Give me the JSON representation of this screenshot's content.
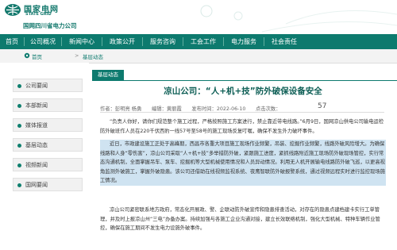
{
  "header": {
    "logo_cn": "国家电网",
    "logo_en": "STATE GRID",
    "company": "国网四川省电力公司"
  },
  "nav": {
    "items": [
      {
        "label": "首页"
      },
      {
        "label": "公司概况"
      },
      {
        "label": "新闻中心"
      },
      {
        "label": "政策公开"
      },
      {
        "label": "服务咨询"
      },
      {
        "label": "工会工作"
      },
      {
        "label": "电力服务"
      },
      {
        "label": "社会责任"
      }
    ]
  },
  "breadcrumb": {
    "home": "首页",
    "sep": ">",
    "current": "基层动态"
  },
  "sidebar": {
    "items": [
      {
        "label": "公司要闻"
      },
      {
        "label": "本部新闻"
      },
      {
        "label": "媒体报道"
      },
      {
        "label": "基层动态"
      },
      {
        "label": "视频新闻"
      },
      {
        "label": "国网要闻"
      }
    ]
  },
  "article": {
    "tab": "基层动态",
    "title": "凉山公司：“人+机+技”防外破保设备安全",
    "meta": "作者：彭明亮 杨勇　　编辑：黄丽霞　　发布时间：2022-06-10　　点击次数：",
    "count": "57",
    "paragraphs": [
      "“负责人你好，请你们规范整个施工过程，严格按照施工方案进行，禁止靠近带电线路。”6月9日，国网凉山供电公司输电运检防外破班作人员在220千伏西豹一线57号至58号的施工现场反复叮嘱，确保不发生外力破坏事件。",
      "近日，市政建设施工正处于高峰期，西昌市各重大项目施工现场作业频繁，吊装、挖掘作业频繁，线路外破风险增大。为确保线路和人身“零伤害”，凉山公司采取“人+机+技”多举措防外破，紧跟施工进度，紧抓线路附近施工现场防外破现场管控，实行常态沟通机制，全面掌握吊车、泵车、挖掘机等大型机械使用情况和人员异动情况。利用无人机开展输电线路防外破飞巡，以更高视角监测外破施工，掌握外破隐患。该公司还借助在线视频监视系统、夜鹰智联防外破报警系统，通过视频远程实时进行监控现场施工情况。",
      "凉山公司紧密联系地方政府，常态化开展政、警、企联动防外破宣传和隐患排查活动，对存在的隐患点建档建卡实行工单管理，并及时上报凉山州“三电”办备办案。持续加强与各施工企业沟通对接，建立长效联络机制，强化大型机械、特种车辆作业管控，确保在施工期间不发生电力设施外破事件。"
    ]
  }
}
